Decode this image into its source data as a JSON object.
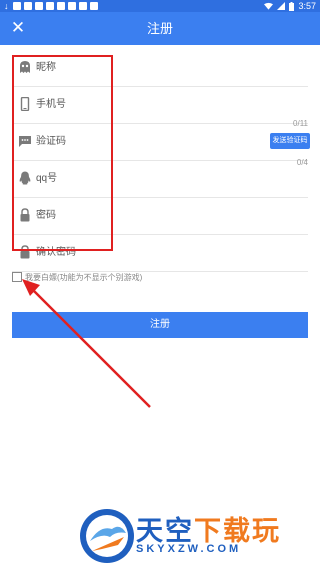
{
  "status_bar": {
    "time": "3:57",
    "download_glyph": "↓",
    "icons": [
      "download-icon",
      "notification-icon",
      "wifi-icon",
      "signal-icon",
      "battery-icon"
    ]
  },
  "app_bar": {
    "close_glyph": "✕",
    "title": "注册"
  },
  "form": {
    "nickname_placeholder": "昵称",
    "phone_placeholder": "手机号",
    "phone_counter": "0/11",
    "code_placeholder": "验证码",
    "send_code_label": "发送验证码",
    "code_counter": "0/4",
    "qq_placeholder": "qq号",
    "password_placeholder": "密码",
    "confirm_password_placeholder": "确认密码"
  },
  "agreement": {
    "checked": false,
    "text": "我要白嫖(功能为不显示个别游戏)"
  },
  "register_button": "注册",
  "watermark": {
    "line1_a": "天空",
    "line1_b": "下载玩",
    "line2": "SKYXZW.COM"
  },
  "colors": {
    "primary": "#3b7ff0",
    "status_bar": "#2f6fe0",
    "annotation_red": "#e02020",
    "watermark_blue": "#1f5fbf",
    "watermark_orange": "#f07a1f"
  }
}
